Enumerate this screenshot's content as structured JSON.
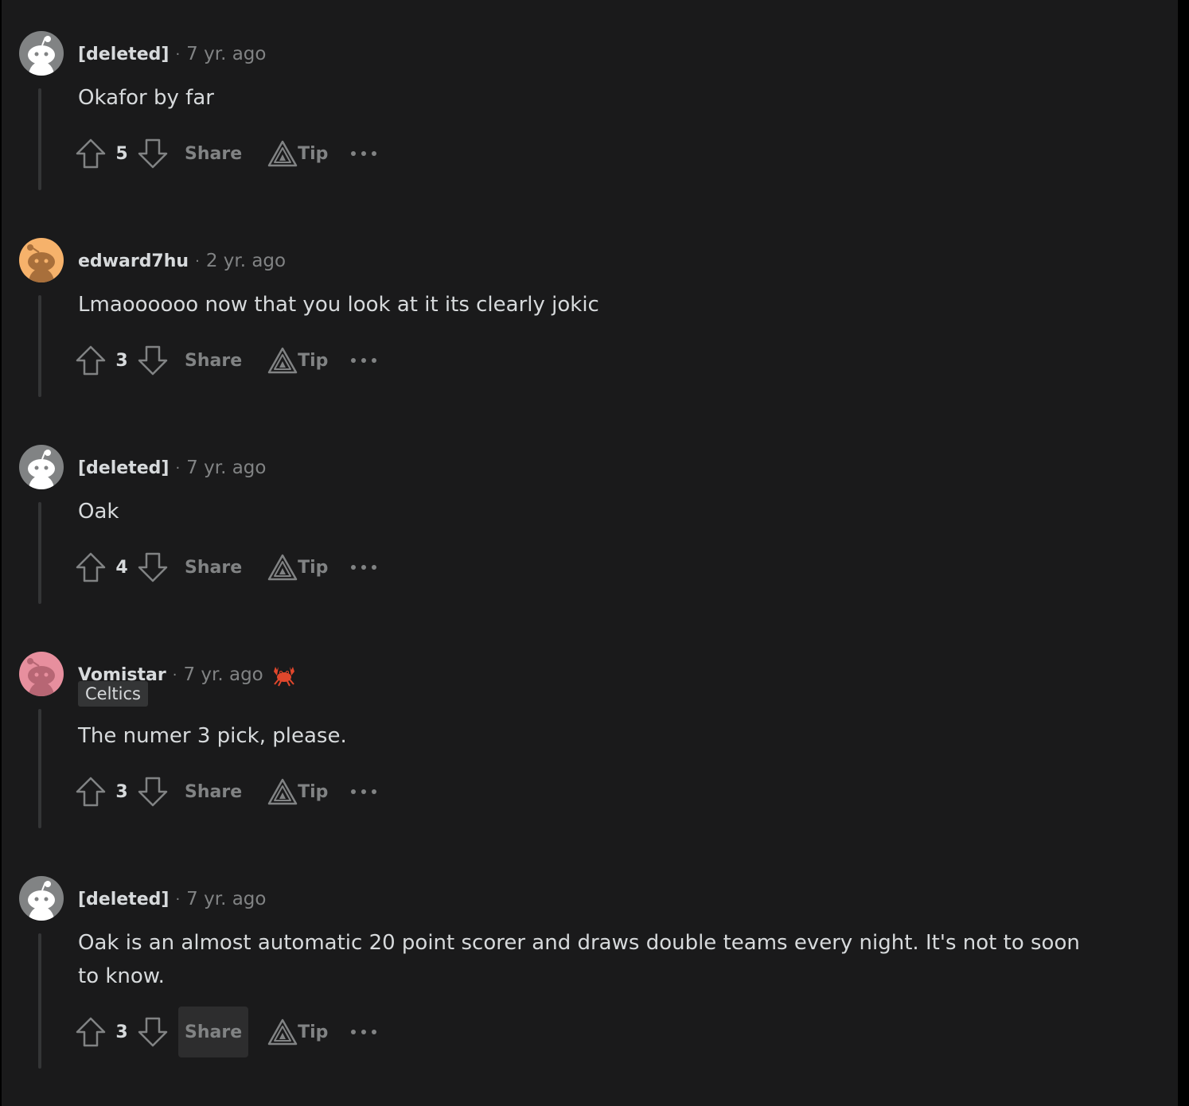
{
  "colors": {
    "background": "#1a1a1b",
    "text": "#d7dadc",
    "muted": "#818384",
    "thread_line": "#343536",
    "avatar_deleted": "#818384",
    "avatar_orange": "#f6b26b",
    "avatar_pink": "#e78f9e"
  },
  "comments": [
    {
      "author": "[deleted]",
      "time": "7 yr. ago",
      "body": "Okafor by far",
      "score": "5",
      "share_label": "Share",
      "tip_label": "Tip",
      "avatar": "deleted-avatar"
    },
    {
      "author": "edward7hu",
      "time": "2 yr. ago",
      "body": "Lmaoooooo now that you look at it its clearly jokic",
      "score": "3",
      "share_label": "Share",
      "tip_label": "Tip",
      "avatar": "orange-avatar"
    },
    {
      "author": "[deleted]",
      "time": "7 yr. ago",
      "body": "Oak",
      "score": "4",
      "share_label": "Share",
      "tip_label": "Tip",
      "avatar": "deleted-avatar"
    },
    {
      "author": "Vomistar",
      "time": "7 yr. ago",
      "flair": "Celtics",
      "award_icon": "crab-award-icon",
      "body": "The numer 3 pick, please.",
      "score": "3",
      "share_label": "Share",
      "tip_label": "Tip",
      "avatar": "pink-avatar"
    },
    {
      "author": "[deleted]",
      "time": "7 yr. ago",
      "body": "Oak is an almost automatic 20 point scorer and draws double teams every night. It's not to soon to know.",
      "score": "3",
      "share_label": "Share",
      "tip_label": "Tip",
      "avatar": "deleted-avatar",
      "share_hovered": true
    }
  ],
  "separator": "·"
}
